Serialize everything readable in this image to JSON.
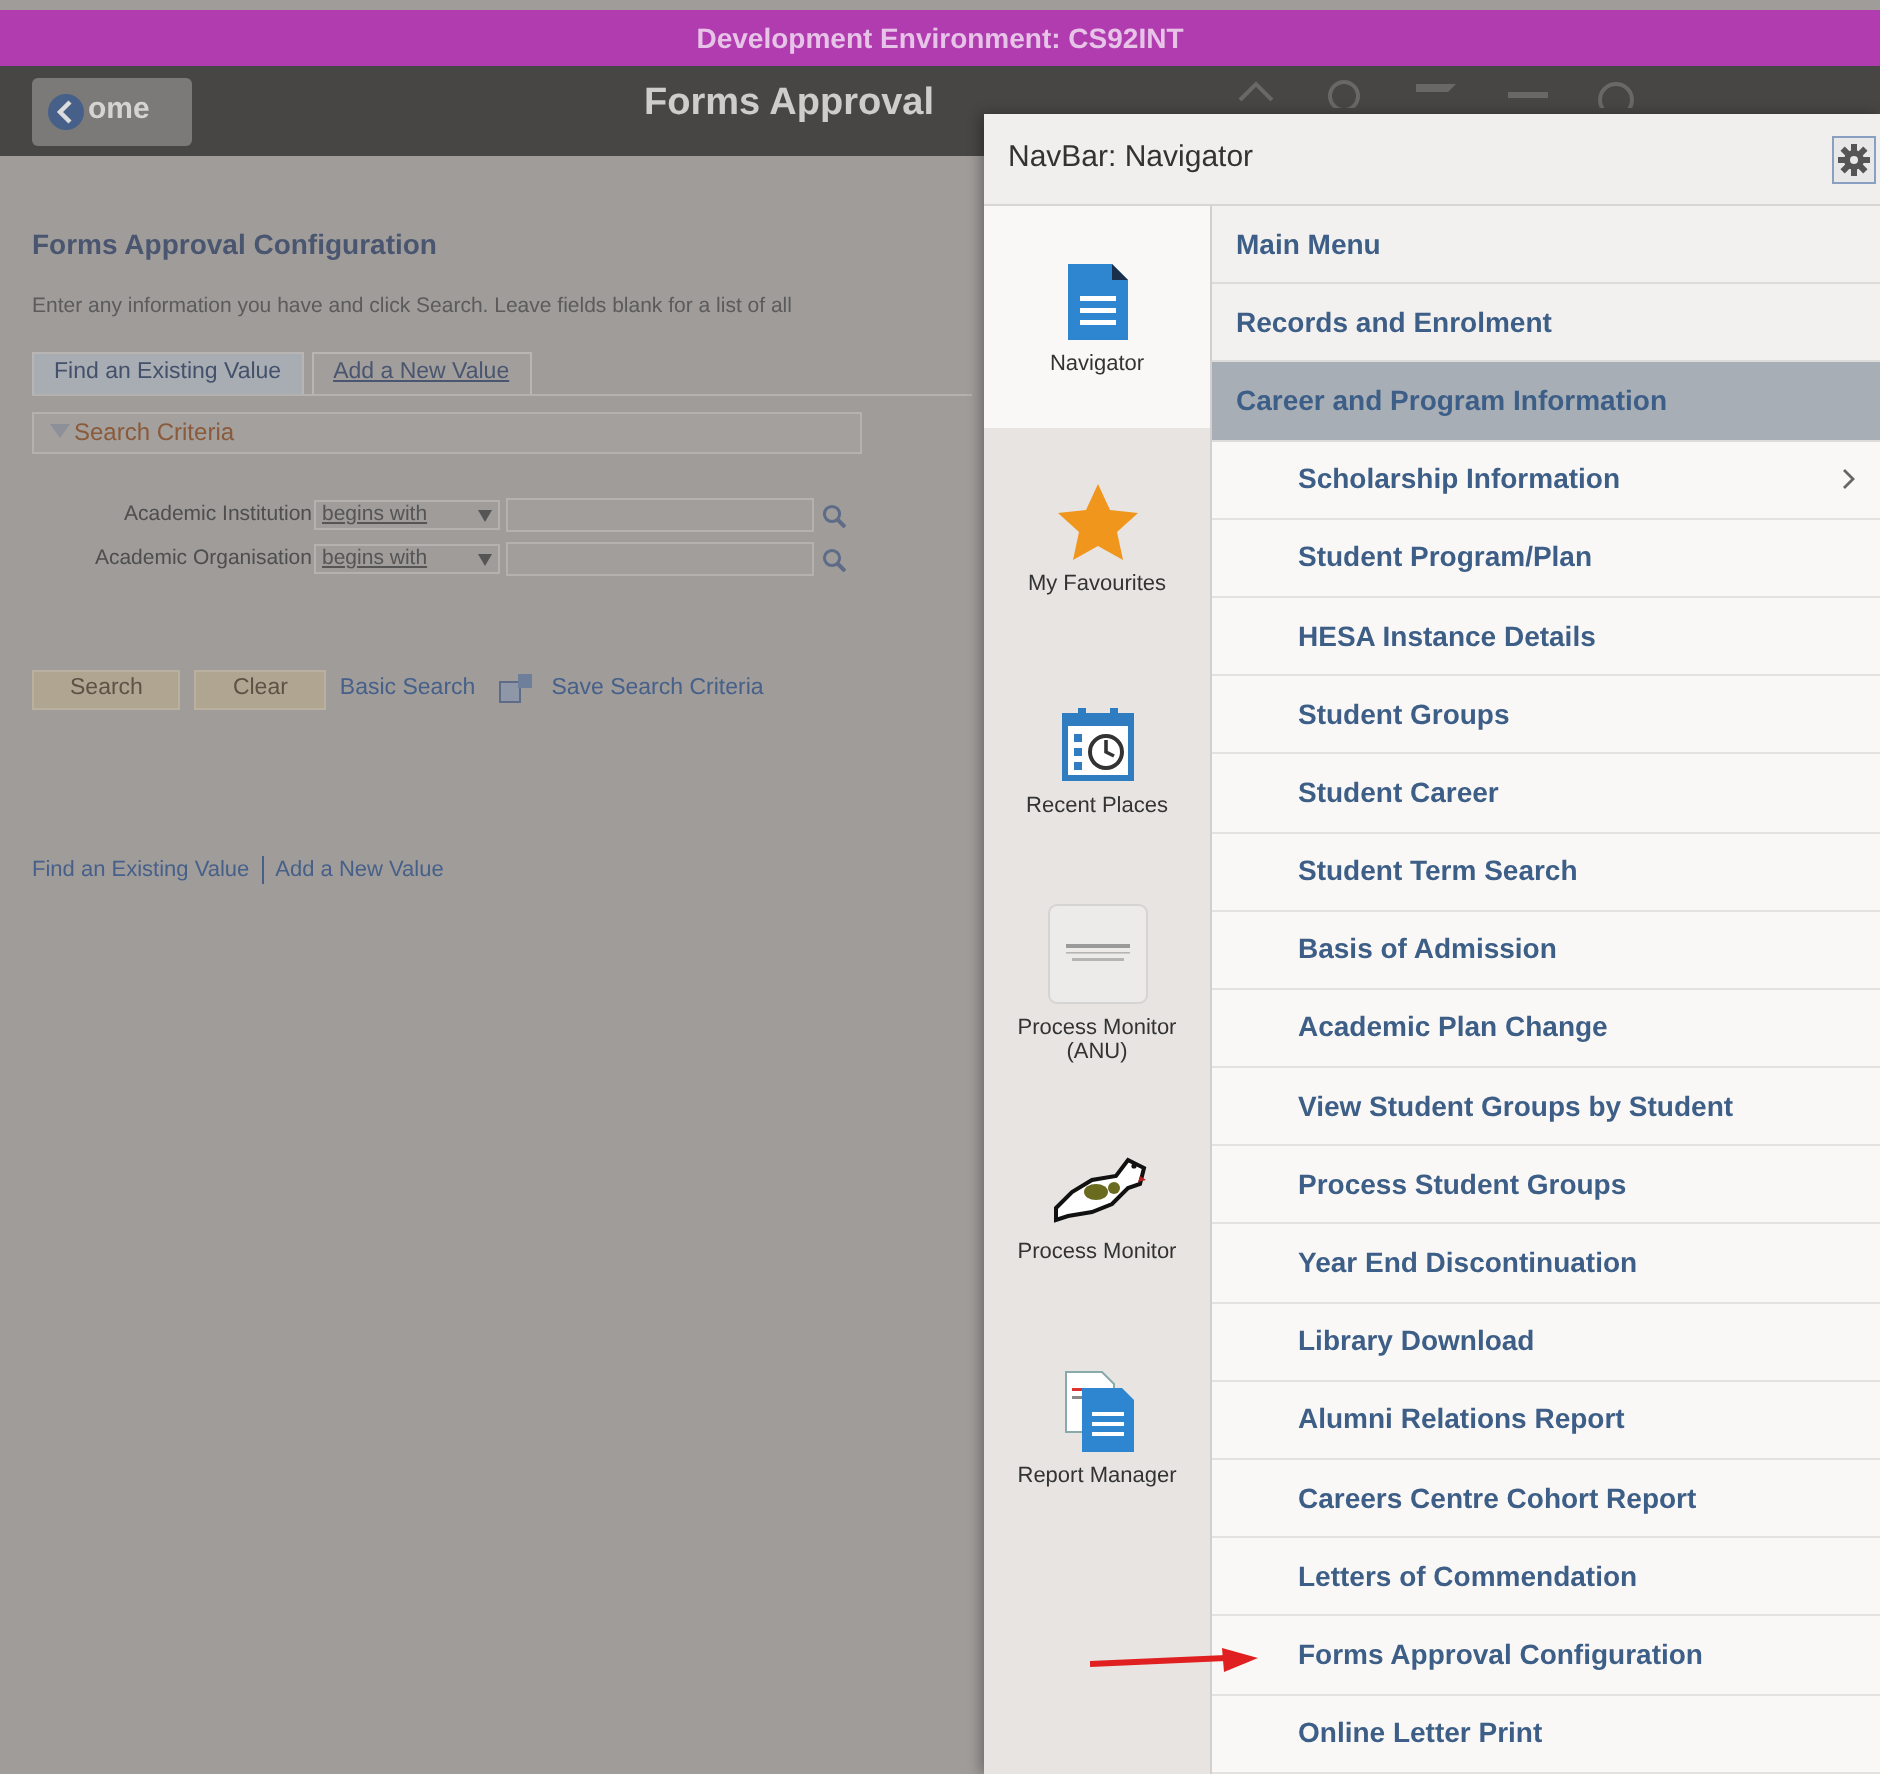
{
  "banner": {
    "text": "Development Environment: CS92INT"
  },
  "header": {
    "back_button": "ome",
    "title": "Forms Approval"
  },
  "page": {
    "title": "Forms Approval Configuration",
    "instructions": "Enter any information you have and click Search. Leave fields blank for a list of all",
    "tabs": [
      {
        "label": "Find an Existing Value",
        "selected": true
      },
      {
        "label": "Add a New Value",
        "selected": false
      }
    ],
    "section": {
      "label": "Search Criteria",
      "expanded": true
    },
    "fields": [
      {
        "label": "Academic Institution",
        "operator": "begins with"
      },
      {
        "label": "Academic Organisation",
        "operator": "begins with"
      }
    ],
    "buttons": [
      "Search",
      "Clear"
    ],
    "links": [
      "Basic Search",
      "Save Search Criteria"
    ],
    "footer_links": [
      "Find an Existing Value",
      "Add a New Value"
    ]
  },
  "navbar": {
    "title": "NavBar: Navigator",
    "tiles": [
      {
        "kind": "navigator",
        "label": "Navigator",
        "selected": true
      },
      {
        "kind": "favourites",
        "label": "My Favourites",
        "selected": false
      },
      {
        "kind": "recent",
        "label": "Recent Places",
        "selected": false
      },
      {
        "kind": "oracle",
        "label": "Process Monitor (ANU)",
        "selected": false
      },
      {
        "kind": "monitor",
        "label": "Process Monitor",
        "selected": false
      },
      {
        "kind": "report",
        "label": "Report Manager",
        "selected": false
      }
    ],
    "items": [
      {
        "label": "Main Menu",
        "selected": false
      },
      {
        "label": "Records and Enrolment",
        "selected": false
      },
      {
        "label": "Career and Program Information",
        "selected": true,
        "children": [
          {
            "label": "Scholarship Information",
            "submenu": true
          },
          {
            "label": "Student Program/Plan",
            "submenu": false
          },
          {
            "label": "HESA Instance Details",
            "submenu": false
          },
          {
            "label": "Student Groups",
            "submenu": false
          },
          {
            "label": "Student Career",
            "submenu": false
          },
          {
            "label": "Student Term Search",
            "submenu": false
          },
          {
            "label": "Basis of Admission",
            "submenu": false
          },
          {
            "label": "Academic Plan Change",
            "submenu": false
          },
          {
            "label": "View Student Groups by Student",
            "submenu": false
          },
          {
            "label": "Process Student Groups",
            "submenu": false
          },
          {
            "label": "Year End Discontinuation",
            "submenu": false
          },
          {
            "label": "Library Download",
            "submenu": false
          },
          {
            "label": "Alumni Relations Report",
            "submenu": false
          },
          {
            "label": "Careers Centre Cohort Report",
            "submenu": false
          },
          {
            "label": "Letters of Commendation",
            "submenu": false
          },
          {
            "label": "Forms Approval Configuration",
            "submenu": false
          },
          {
            "label": "Online Letter Print",
            "submenu": false
          }
        ]
      }
    ]
  }
}
